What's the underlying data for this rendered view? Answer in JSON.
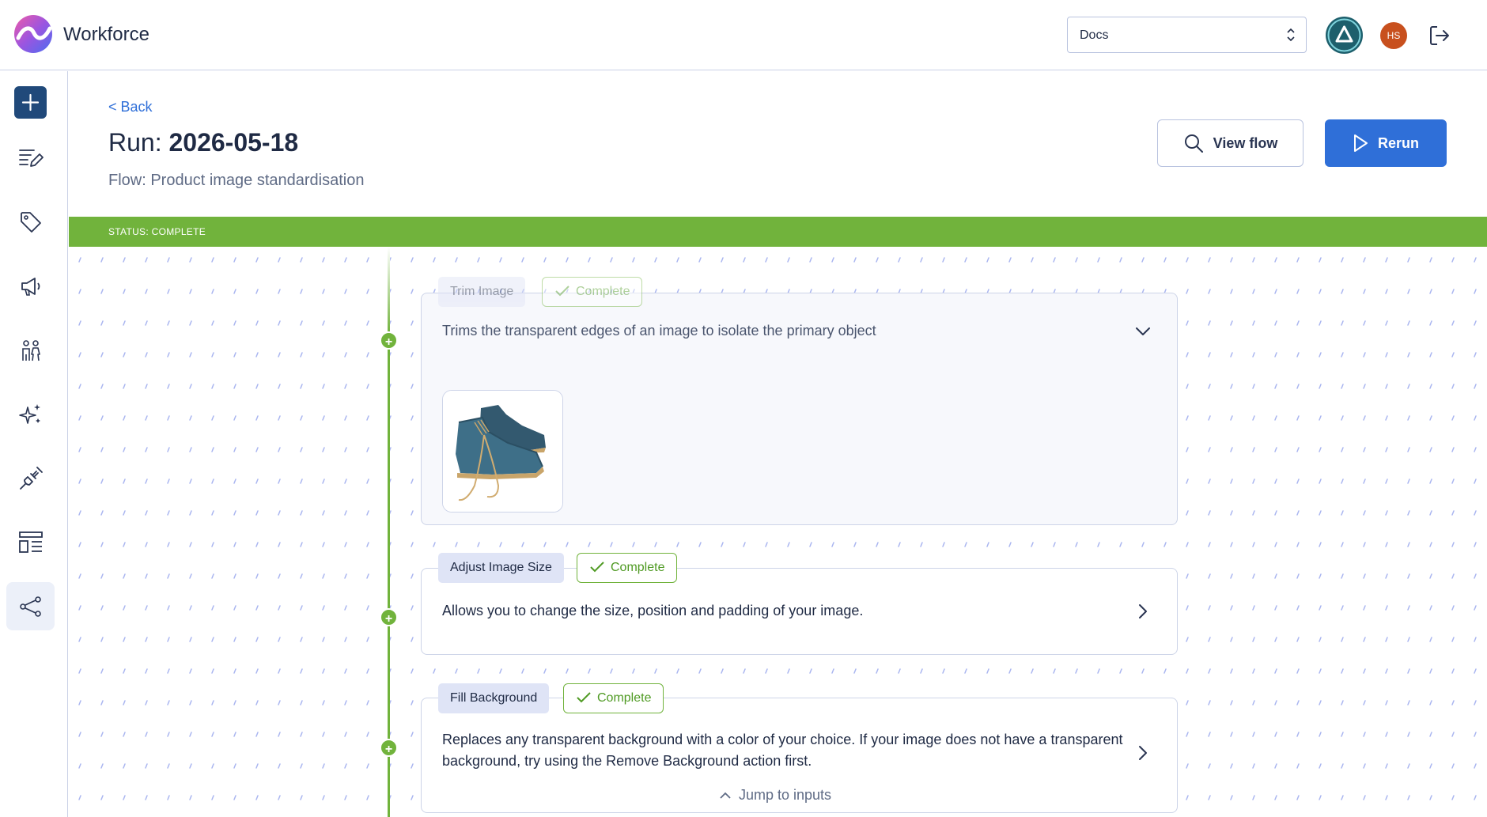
{
  "app": {
    "brand": "Workforce"
  },
  "header": {
    "org_select": "Docs",
    "user_initials": "HS",
    "colors": {
      "avatar": "#c8501e",
      "app_badge": "#1d5f6c",
      "accent": "#2f6fd8",
      "success": "#71b33c"
    }
  },
  "sidebar": {
    "items": [
      {
        "icon": "plus-icon",
        "active": false
      },
      {
        "icon": "edit-list-icon",
        "active": false
      },
      {
        "icon": "tag-icon",
        "active": false
      },
      {
        "icon": "megaphone-icon",
        "active": false
      },
      {
        "icon": "people-icon",
        "active": false
      },
      {
        "icon": "sparkles-icon",
        "active": false
      },
      {
        "icon": "plug-icon",
        "active": false
      },
      {
        "icon": "layout-icon",
        "active": false
      },
      {
        "icon": "flow-icon",
        "active": true
      }
    ]
  },
  "page": {
    "back_label": "< Back",
    "run_prefix": "Run: ",
    "run_date": "2026-05-18",
    "flow_label": "Flow: Product image standardisation",
    "view_flow_label": "View flow",
    "rerun_label": "Rerun",
    "status_label": "STATUS: COMPLETE"
  },
  "steps": [
    {
      "name": "Trim Image",
      "status": "Complete",
      "description": "Trims the transparent edges of an image to isolate the primary object",
      "expanded": true,
      "output_image": "blue suede chukka boots"
    },
    {
      "name": "Adjust Image Size",
      "status": "Complete",
      "description": "Allows you to change the size, position and padding of your image.",
      "expanded": false
    },
    {
      "name": "Fill Background",
      "status": "Complete",
      "description": "Replaces any transparent background with a color of your choice. If your image does not have a transparent background, try using the Remove Background action first.",
      "expanded": false
    }
  ],
  "jump_label": "Jump to inputs"
}
